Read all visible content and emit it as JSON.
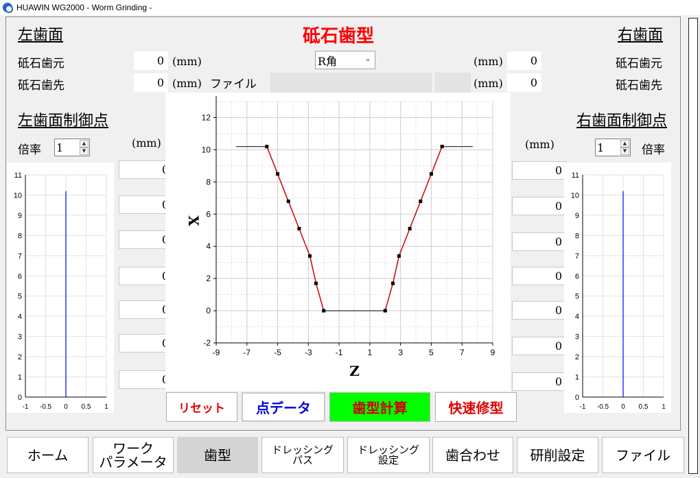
{
  "window": {
    "title": "HUAWIN WG2000 - Worm Grinding -"
  },
  "header": {
    "left_title": "左歯面",
    "main_title": "砥石歯型",
    "right_title": "右歯面"
  },
  "left_side": {
    "base_label": "砥石歯元",
    "base_value": "0",
    "base_unit": "(mm)",
    "tip_label": "砥石歯先",
    "tip_value": "0",
    "tip_unit": "(mm)",
    "control_title": "左歯面制御点",
    "ratio_label": "倍率",
    "ratio_value": "1",
    "points_unit": "(mm)",
    "points": [
      "0",
      "0",
      "0",
      "0",
      "0",
      "0",
      "0"
    ]
  },
  "right_side": {
    "base_label": "砥石歯元",
    "base_value": "0",
    "base_unit": "(mm)",
    "tip_label": "砥石歯先",
    "tip_value": "0",
    "tip_unit": "(mm)",
    "control_title": "右歯面制御点",
    "ratio_label": "倍率",
    "ratio_value": "1",
    "points_unit": "(mm)",
    "points": [
      "0",
      "0",
      "0",
      "0",
      "0",
      "0",
      "0"
    ]
  },
  "center": {
    "corner_select": "R角",
    "file_label": "ファイル",
    "file_value": ""
  },
  "buttons": {
    "reset": "リセット",
    "point_data": "点データ",
    "profile_calc": "歯型計算",
    "quick_modify": "快速修型"
  },
  "colors": {
    "title_red": "#ff0000",
    "reset_text": "#e00000",
    "point_data_text": "#0000e0",
    "profile_calc_bg": "#00ff00",
    "quick_modify_text": "#e00000",
    "profile_line": "#cc0000",
    "mini_line": "#0000ff"
  },
  "nav": {
    "home": "ホーム",
    "work_params": "ワーク\nパラメータ",
    "tooth_profile": "歯型",
    "dressing_path": "ドレッシング\nパス",
    "dressing_settings": "ドレッシング\n設定",
    "meshing": "歯合わせ",
    "grinding_settings": "研削設定",
    "file": "ファイル"
  },
  "chart_data": [
    {
      "type": "line",
      "xlabel": "Z",
      "ylabel": "X",
      "xlim": [
        -9,
        9
      ],
      "ylim": [
        -2,
        13
      ],
      "xticks": [
        "-9",
        "-7",
        "-5",
        "-3",
        "-1",
        "1",
        "3",
        "5",
        "7",
        "9"
      ],
      "yticks": [
        "-2",
        "0",
        "2",
        "4",
        "6",
        "8",
        "10",
        "12"
      ],
      "grid": true,
      "series": [
        {
          "values": [
            [
              -7.7,
              10.2
            ],
            [
              -5.7,
              10.2
            ]
          ]
        },
        {
          "values": [
            [
              -5.7,
              10.2
            ],
            [
              -5.0,
              8.5
            ],
            [
              -4.3,
              6.8
            ],
            [
              -3.6,
              5.1
            ],
            [
              -2.9,
              3.4
            ],
            [
              -2.5,
              1.7
            ],
            [
              -2.0,
              0
            ]
          ]
        },
        {
          "values": [
            [
              -2.0,
              0
            ],
            [
              2.0,
              0
            ]
          ]
        },
        {
          "values": [
            [
              2.0,
              0
            ],
            [
              2.5,
              1.7
            ],
            [
              2.9,
              3.4
            ],
            [
              3.6,
              5.1
            ],
            [
              4.3,
              6.8
            ],
            [
              5.0,
              8.5
            ],
            [
              5.7,
              10.2
            ]
          ]
        },
        {
          "values": [
            [
              5.7,
              10.2
            ],
            [
              7.7,
              10.2
            ]
          ]
        }
      ]
    },
    {
      "type": "line",
      "xlim": [
        -1,
        1
      ],
      "ylim": [
        0,
        11
      ],
      "xticks": [
        "-1",
        "-0.5",
        "0",
        "0.5",
        "1"
      ],
      "yticks": [
        "0",
        "1",
        "2",
        "3",
        "4",
        "5",
        "6",
        "7",
        "8",
        "9",
        "10",
        "11"
      ],
      "grid": true,
      "series": [
        {
          "values": [
            [
              0,
              0
            ],
            [
              0,
              10.2
            ]
          ]
        }
      ]
    },
    {
      "type": "line",
      "xlim": [
        -1,
        1
      ],
      "ylim": [
        0,
        11
      ],
      "xticks": [
        "-1",
        "-0.5",
        "0",
        "0.5",
        "1"
      ],
      "yticks": [
        "0",
        "1",
        "2",
        "3",
        "4",
        "5",
        "6",
        "7",
        "8",
        "9",
        "10",
        "11"
      ],
      "grid": true,
      "series": [
        {
          "values": [
            [
              0,
              0
            ],
            [
              0,
              10.2
            ]
          ]
        }
      ]
    }
  ]
}
